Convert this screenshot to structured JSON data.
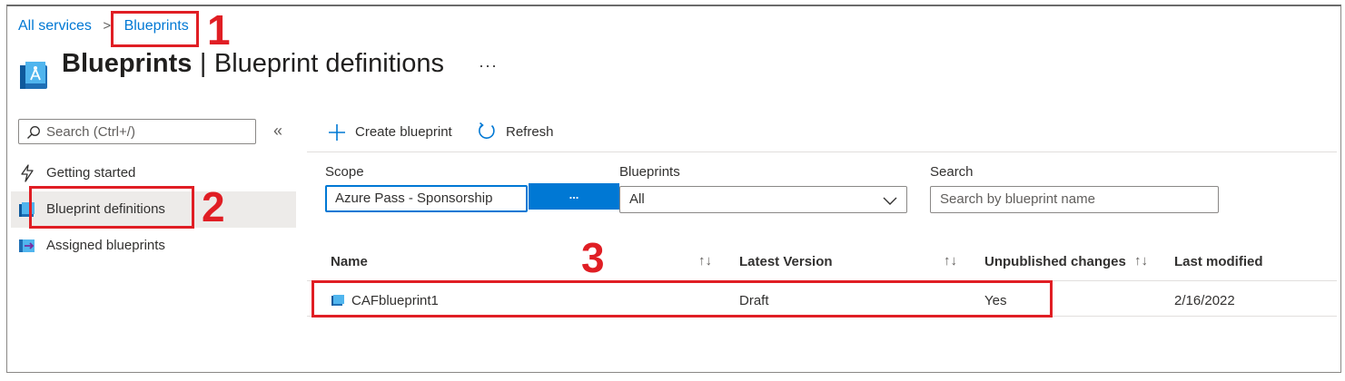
{
  "breadcrumb": {
    "root": "All services",
    "separator": ">",
    "current": "Blueprints"
  },
  "title": {
    "primary": "Blueprints",
    "separator": "|",
    "secondary": "Blueprint definitions",
    "more": "···"
  },
  "nav": {
    "search_placeholder": "Search (Ctrl+/)",
    "collapse": "«",
    "items": [
      {
        "label": "Getting started",
        "icon": "lightning-icon"
      },
      {
        "label": "Blueprint definitions",
        "icon": "blueprint-definitions-icon"
      },
      {
        "label": "Assigned blueprints",
        "icon": "assigned-blueprints-icon"
      }
    ]
  },
  "toolbar": {
    "create": "Create blueprint",
    "refresh": "Refresh"
  },
  "filters": {
    "scope_label": "Scope",
    "scope_value": "Azure Pass - Sponsorship",
    "scope_button": "...",
    "blueprints_label": "Blueprints",
    "blueprints_value": "All",
    "search_label": "Search",
    "search_placeholder": "Search by blueprint name"
  },
  "table": {
    "columns": [
      "Name",
      "Latest Version",
      "Unpublished changes",
      "Last modified"
    ],
    "sort_glyph": "↑↓",
    "rows": [
      {
        "name": "CAFblueprint1",
        "latest_version": "Draft",
        "unpublished_changes": "Yes",
        "last_modified": "2/16/2022"
      }
    ]
  },
  "annotations": [
    "1",
    "2",
    "3"
  ],
  "colors": {
    "accent": "#0078d4",
    "annotation_red": "#e01e24",
    "selected_bg": "#edebe9"
  }
}
